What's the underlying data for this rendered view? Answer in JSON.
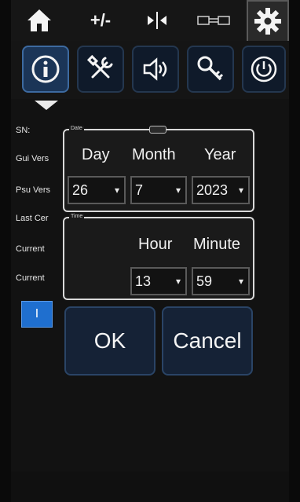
{
  "tabs": [
    {
      "label": "",
      "icon": "home-icon"
    },
    {
      "label": "+/-",
      "icon": ""
    },
    {
      "label": "",
      "icon": "align-icon"
    },
    {
      "label": "",
      "icon": "connector-icon"
    },
    {
      "label": "",
      "icon": "gear-icon"
    }
  ],
  "icon_buttons": [
    {
      "icon": "info-icon"
    },
    {
      "icon": "tools-icon"
    },
    {
      "icon": "speaker-icon"
    },
    {
      "icon": "key-icon"
    },
    {
      "icon": "power-icon"
    }
  ],
  "background_labels": {
    "sn": "SN:",
    "gui_version": "Gui Vers",
    "psu_version": "Psu Vers",
    "last_cert": "Last Cer",
    "current1": "Current",
    "current2": "Current"
  },
  "blue_button": {
    "label": "I"
  },
  "date_panel": {
    "caption": "Date",
    "headers": {
      "day": "Day",
      "month": "Month",
      "year": "Year"
    },
    "values": {
      "day": "26",
      "month": "7",
      "year": "2023"
    }
  },
  "time_panel": {
    "caption": "Time",
    "headers": {
      "hour": "Hour",
      "minute": "Minute"
    },
    "values": {
      "hour": "13",
      "minute": "59"
    }
  },
  "buttons": {
    "ok": "OK",
    "cancel": "Cancel"
  },
  "colors": {
    "accent_blue": "#1f6fcf",
    "button_bg": "#152236"
  }
}
